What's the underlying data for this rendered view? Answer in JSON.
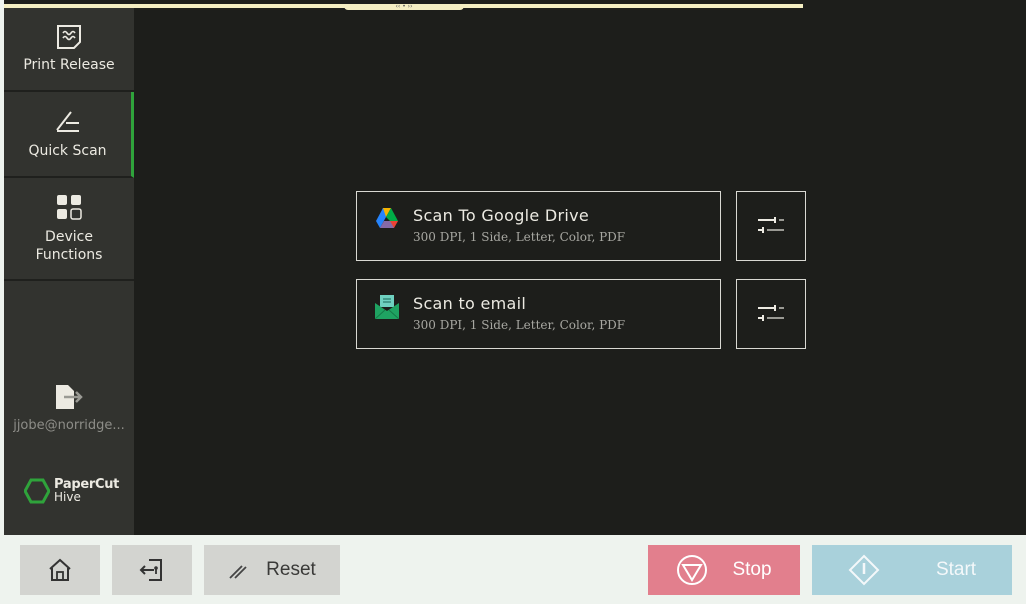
{
  "sidebar": {
    "items": [
      {
        "label": "Print Release",
        "icon": "print-release-icon"
      },
      {
        "label": "Quick Scan",
        "icon": "quick-scan-icon",
        "active": true
      },
      {
        "label": "Device Functions",
        "icon": "device-functions-icon"
      }
    ],
    "user": {
      "label": "jjobe@norridge...",
      "icon": "logout-icon"
    },
    "logo": {
      "line1": "PaperCut",
      "line2": "Hive"
    }
  },
  "top_handle": "‹‹ • ››",
  "scans": [
    {
      "title": "Scan To Google Drive",
      "details": "300 DPI, 1 Side, Letter, Color, PDF",
      "icon": "google-drive-icon"
    },
    {
      "title": "Scan to email",
      "details": "300 DPI, 1 Side, Letter, Color, PDF",
      "icon": "email-icon"
    }
  ],
  "options_icon": "settings-sliders-icon",
  "bottom": {
    "home_icon": "home-icon",
    "logout_icon": "device-logout-icon",
    "reset_label": "Reset",
    "stop_label": "Stop",
    "start_label": "Start"
  },
  "colors": {
    "accent": "#2fa33b",
    "stop": "#e27f8d",
    "start": "#a9d1db",
    "background": "#1d1e1b"
  }
}
